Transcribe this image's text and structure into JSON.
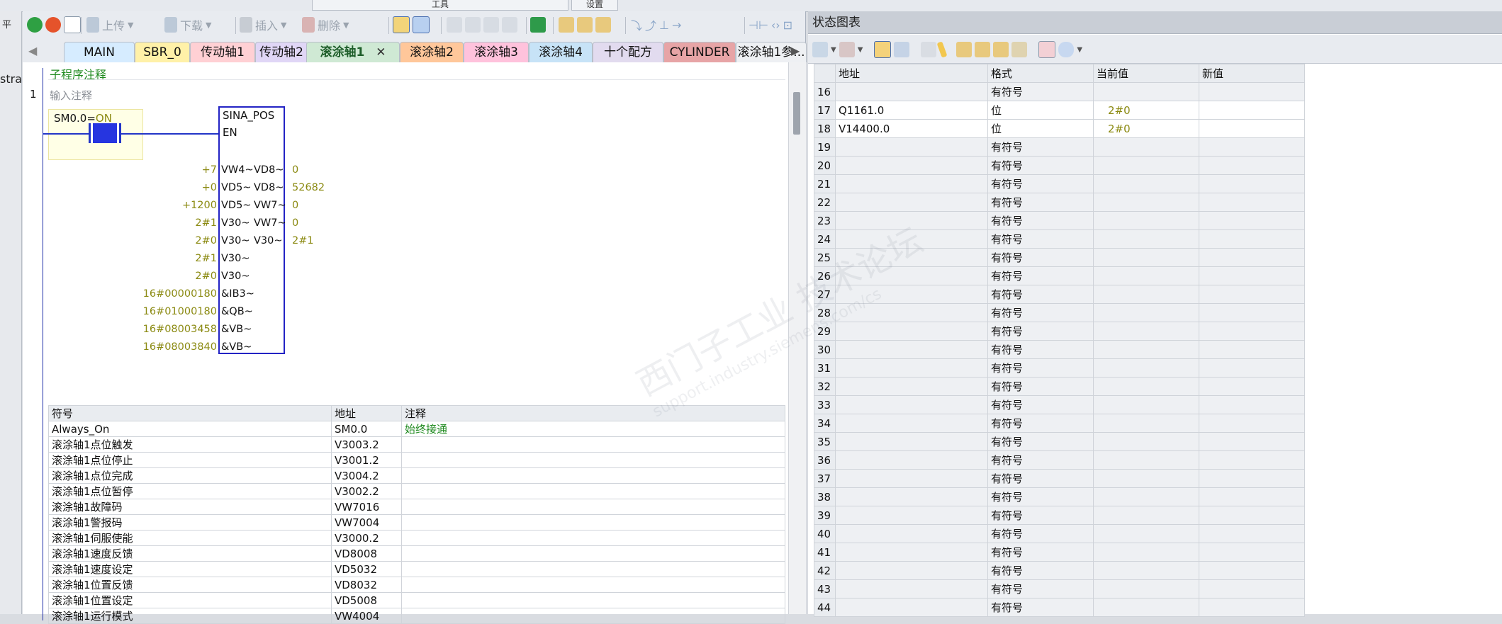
{
  "top_strip": {
    "tabs": [
      "工具",
      "设置"
    ]
  },
  "left_edge": {
    "pin": "平",
    "text": "stra"
  },
  "toolbar": {
    "upload": "上传",
    "download": "下载",
    "insert": "插入",
    "delete": "删除"
  },
  "pou_tabs": [
    "MAIN",
    "SBR_0",
    "传动轴1",
    "传动轴2",
    "滚涂轴1",
    "滚涂轴2",
    "滚涂轴3",
    "滚涂轴4",
    "十个配方",
    "CYLINDER",
    "滚涂轴1参..."
  ],
  "editor": {
    "subroutine_comment": "子程序注释",
    "network_number": "1",
    "network_comment_placeholder": "输入注释",
    "contact_label": "SM0.0=",
    "contact_state": "ON",
    "block_name": "SINA_POS",
    "en_label": "EN",
    "inputs": [
      {
        "value": "+7",
        "pin": "VW4~"
      },
      {
        "value": "+0",
        "pin": "VD5~"
      },
      {
        "value": "+1200",
        "pin": "VD5~"
      },
      {
        "value": "2#1",
        "pin": "V30~"
      },
      {
        "value": "2#0",
        "pin": "V30~"
      },
      {
        "value": "2#1",
        "pin": "V30~"
      },
      {
        "value": "2#0",
        "pin": "V30~"
      },
      {
        "value": "16#00000180",
        "pin": "&IB3~"
      },
      {
        "value": "16#01000180",
        "pin": "&QB~"
      },
      {
        "value": "16#08003458",
        "pin": "&VB~"
      },
      {
        "value": "16#08003840",
        "pin": "&VB~"
      }
    ],
    "outputs": [
      {
        "pin": "VD8~",
        "value": "0"
      },
      {
        "pin": "VD8~",
        "value": "52682"
      },
      {
        "pin": "VW7~",
        "value": "0"
      },
      {
        "pin": "VW7~",
        "value": "0"
      },
      {
        "pin": "V30~",
        "value": "2#1"
      }
    ]
  },
  "symbol_table": {
    "headers": [
      "符号",
      "地址",
      "注释"
    ],
    "rows": [
      [
        "Always_On",
        "SM0.0",
        "始终接通"
      ],
      [
        "滚涂轴1点位触发",
        "V3003.2",
        ""
      ],
      [
        "滚涂轴1点位停止",
        "V3001.2",
        ""
      ],
      [
        "滚涂轴1点位完成",
        "V3004.2",
        ""
      ],
      [
        "滚涂轴1点位暂停",
        "V3002.2",
        ""
      ],
      [
        "滚涂轴1故障码",
        "VW7016",
        ""
      ],
      [
        "滚涂轴1警报码",
        "VW7004",
        ""
      ],
      [
        "滚涂轴1伺服使能",
        "V3000.2",
        ""
      ],
      [
        "滚涂轴1速度反馈",
        "VD8008",
        ""
      ],
      [
        "滚涂轴1速度设定",
        "VD5032",
        ""
      ],
      [
        "滚涂轴1位置反馈",
        "VD8032",
        ""
      ],
      [
        "滚涂轴1位置设定",
        "VD5008",
        ""
      ],
      [
        "滚涂轴1运行模式",
        "VW4004",
        ""
      ]
    ]
  },
  "status_chart": {
    "title": "状态图表",
    "headers": [
      "地址",
      "格式",
      "当前值",
      "新值"
    ],
    "rows": [
      [
        "16",
        "",
        "有符号",
        "",
        ""
      ],
      [
        "17",
        "Q1161.0",
        "位",
        "2#0",
        ""
      ],
      [
        "18",
        "V14400.0",
        "位",
        "2#0",
        ""
      ],
      [
        "19",
        "",
        "有符号",
        "",
        ""
      ],
      [
        "20",
        "",
        "有符号",
        "",
        ""
      ],
      [
        "21",
        "",
        "有符号",
        "",
        ""
      ],
      [
        "22",
        "",
        "有符号",
        "",
        ""
      ],
      [
        "23",
        "",
        "有符号",
        "",
        ""
      ],
      [
        "24",
        "",
        "有符号",
        "",
        ""
      ],
      [
        "25",
        "",
        "有符号",
        "",
        ""
      ],
      [
        "26",
        "",
        "有符号",
        "",
        ""
      ],
      [
        "27",
        "",
        "有符号",
        "",
        ""
      ],
      [
        "28",
        "",
        "有符号",
        "",
        ""
      ],
      [
        "29",
        "",
        "有符号",
        "",
        ""
      ],
      [
        "30",
        "",
        "有符号",
        "",
        ""
      ],
      [
        "31",
        "",
        "有符号",
        "",
        ""
      ],
      [
        "32",
        "",
        "有符号",
        "",
        ""
      ],
      [
        "33",
        "",
        "有符号",
        "",
        ""
      ],
      [
        "34",
        "",
        "有符号",
        "",
        ""
      ],
      [
        "35",
        "",
        "有符号",
        "",
        ""
      ],
      [
        "36",
        "",
        "有符号",
        "",
        ""
      ],
      [
        "37",
        "",
        "有符号",
        "",
        ""
      ],
      [
        "38",
        "",
        "有符号",
        "",
        ""
      ],
      [
        "39",
        "",
        "有符号",
        "",
        ""
      ],
      [
        "40",
        "",
        "有符号",
        "",
        ""
      ],
      [
        "41",
        "",
        "有符号",
        "",
        ""
      ],
      [
        "42",
        "",
        "有符号",
        "",
        ""
      ],
      [
        "43",
        "",
        "有符号",
        "",
        ""
      ],
      [
        "44",
        "",
        "有符号",
        "",
        ""
      ]
    ]
  },
  "watermark": {
    "line1": "西门子工业 技术论坛",
    "line2": "support.industry.siemens.com/cs"
  },
  "colors": {
    "active_tab": "#2f7d3b",
    "value_olive": "#8b8a12",
    "comment_green": "#1f8a1f",
    "block_border": "#2323c4",
    "contact_fill": "#2635e0"
  }
}
